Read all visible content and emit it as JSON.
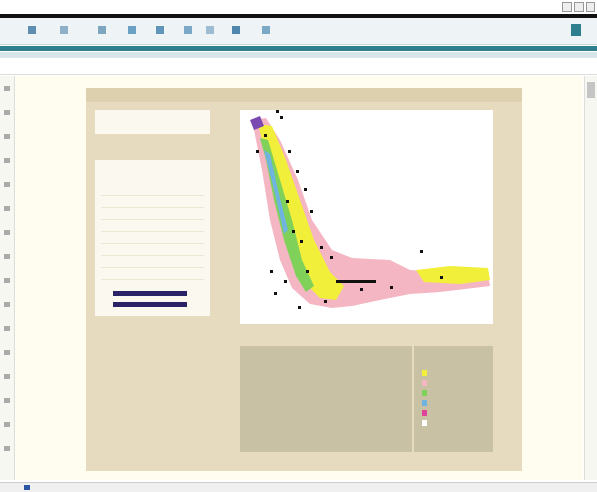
{
  "window": {
    "title": "",
    "accent": "#2f7f8f",
    "brand": "#2a2366"
  },
  "toolbar": {
    "icons": [
      "back-icon",
      "forward-icon",
      "stop-icon",
      "refresh-icon",
      "home-icon",
      "search-icon",
      "favorites-icon",
      "history-icon",
      "mail-icon",
      "print-icon"
    ]
  },
  "addressbar": {
    "text": ""
  },
  "app": {
    "header_title": "",
    "header_right": ""
  },
  "legend": {
    "line1": "",
    "line2": ""
  },
  "panel": {
    "heading": "",
    "rows": [
      {
        "key": "",
        "value": ""
      },
      {
        "key": "",
        "value": ""
      },
      {
        "key": "",
        "value": ""
      },
      {
        "key": "",
        "value": ""
      },
      {
        "key": "",
        "value": ""
      },
      {
        "key": "",
        "value": ""
      },
      {
        "key": "",
        "value": ""
      },
      {
        "key": "",
        "value": ""
      }
    ]
  },
  "map": {
    "colors": {
      "yellow": "#f2ef3a",
      "pink": "#f4b6c2",
      "green": "#7fd15a",
      "blue": "#6fb4e0",
      "black": "#111111",
      "purple": "#7a4ab0"
    }
  },
  "info": {
    "text": ""
  },
  "detail": {
    "line1": "",
    "line2": "",
    "link1": "",
    "link2": ""
  },
  "key": {
    "heading": "",
    "swatches": [
      {
        "color": "#f2ef3a",
        "label": ""
      },
      {
        "color": "#f4b6c2",
        "label": ""
      },
      {
        "color": "#7fd15a",
        "label": ""
      },
      {
        "color": "#6fb4e0",
        "label": ""
      },
      {
        "color": "#e0429a",
        "label": ""
      },
      {
        "color": "#ffffff",
        "label": ""
      }
    ]
  }
}
